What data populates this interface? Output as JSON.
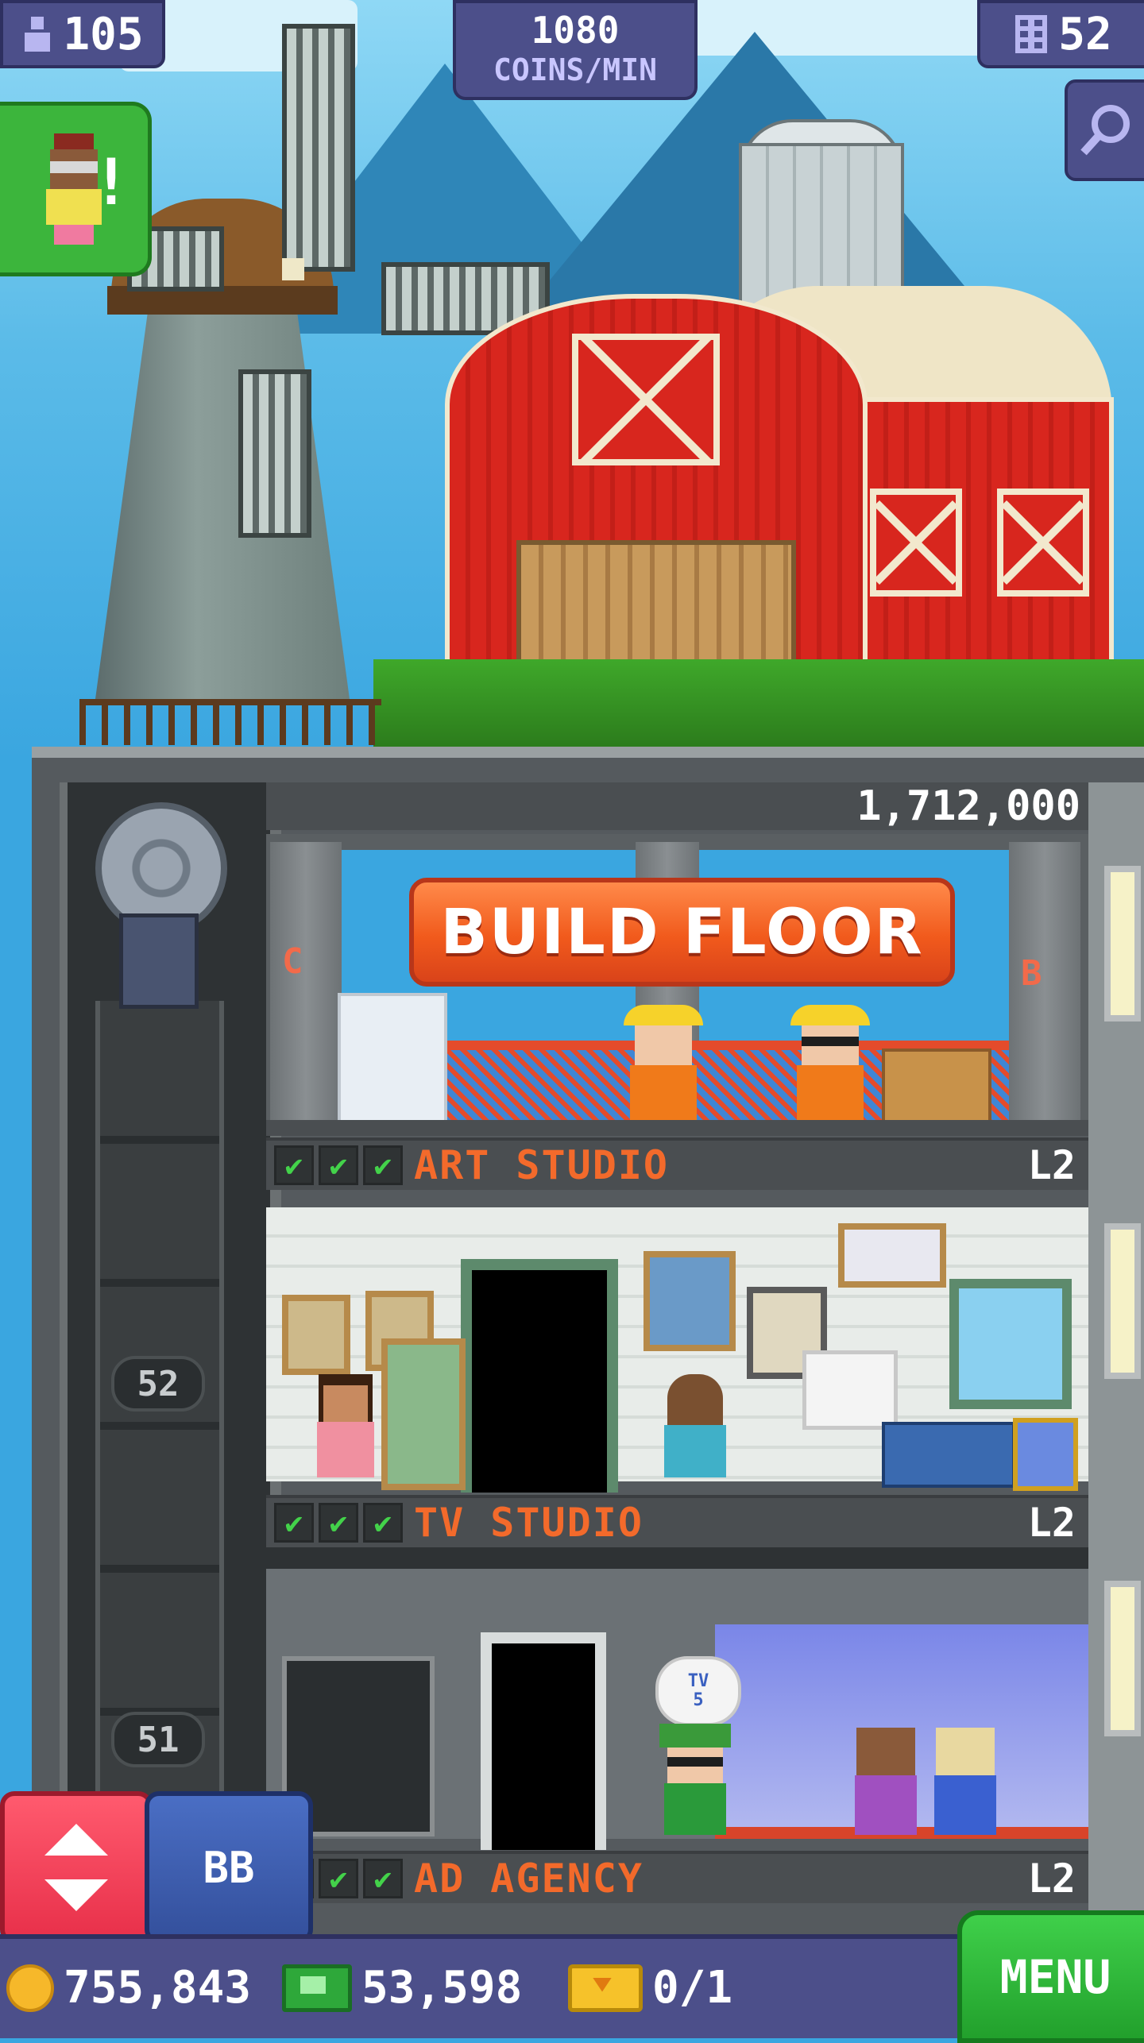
{
  "hud": {
    "population": "105",
    "coin_rate_value": "1080",
    "coin_rate_label": "COINS/MIN",
    "floor_count": "52"
  },
  "icons": {
    "population": "person-icon",
    "floors": "building-icon",
    "zoom": "magnifier-icon",
    "elevator": "up-down-arrows-icon",
    "coins": "coin-icon",
    "bux": "bux-banknote-icon",
    "tickets": "golden-ticket-icon"
  },
  "construction": {
    "cost": "1,712,000",
    "button_label": "BUILD FLOOR",
    "left_letter": "C",
    "right_letter": "B"
  },
  "elevator": {
    "floor_labels": [
      "52",
      "51"
    ],
    "bb_label": "BB"
  },
  "floors": [
    {
      "name": "ART STUDIO",
      "level": "L2",
      "checks": 3
    },
    {
      "name": "TV STUDIO",
      "level": "L2",
      "checks": 3
    },
    {
      "name": "AD AGENCY",
      "level": "L2",
      "checks": 3
    }
  ],
  "tv_bubble": {
    "line1": "TV",
    "line2": "5"
  },
  "currency": {
    "coins": "755,843",
    "bux": "53,598",
    "tickets": "0/1"
  },
  "menu_label": "MENU",
  "notification_mark": "!",
  "colors": {
    "hud": "#4c4f8a",
    "build_button": "#f15a1c",
    "floor_name": "#f36a2b",
    "check": "#43d24a",
    "menu": "#22a02c",
    "elevator_button": "#e8304a",
    "bb_button": "#34509c"
  }
}
